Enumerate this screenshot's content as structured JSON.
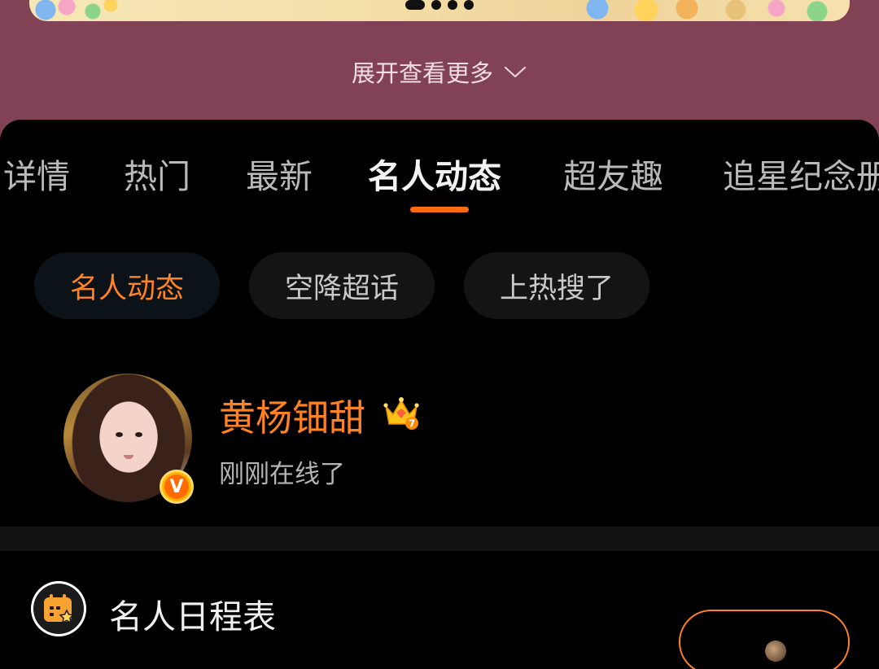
{
  "banner": {
    "pager_dots": 4
  },
  "expand": {
    "label": "展开查看更多"
  },
  "tabs": [
    {
      "label": "详情"
    },
    {
      "label": "热门"
    },
    {
      "label": "最新"
    },
    {
      "label": "名人动态",
      "active": true
    },
    {
      "label": "超友趣"
    },
    {
      "label": "追星纪念册"
    }
  ],
  "chips": [
    {
      "label": "名人动态",
      "active": true
    },
    {
      "label": "空降超话"
    },
    {
      "label": "上热搜了"
    }
  ],
  "celebrity": {
    "name": "黄杨钿甜",
    "status": "刚刚在线了",
    "verified_badge": "V",
    "level_badge": "7"
  },
  "schedule": {
    "title": "名人日程表"
  },
  "colors": {
    "accent": "#ff8224",
    "tab_underline": "#ff6a13",
    "background_top": "#824255",
    "panel": "#000000"
  },
  "icons": {
    "expand": "chevron-down-icon",
    "level": "crown-icon",
    "verified": "v-verified-icon",
    "schedule": "calendar-star-icon"
  }
}
